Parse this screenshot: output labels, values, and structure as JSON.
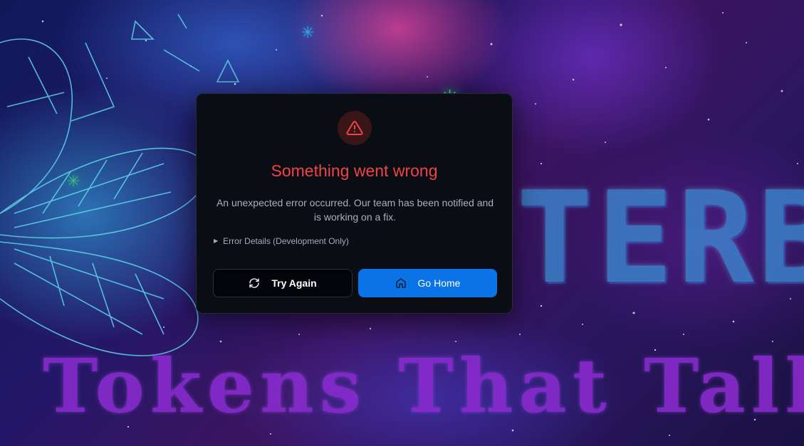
{
  "background": {
    "banner_word": "TERBY",
    "tagline": "Tokens That Talk",
    "colors": {
      "banner_word": "#3d8fd6",
      "tagline": "#8b2bd1",
      "sparkle": "#4ade80"
    }
  },
  "error_card": {
    "icon": "alert-triangle-icon",
    "title": "Something went wrong",
    "message": "An unexpected error occurred. Our team has been notified and is working on a fix.",
    "details_toggle": "Error Details (Development Only)",
    "details_expanded": false,
    "buttons": {
      "try_again": {
        "label": "Try Again",
        "icon": "refresh-icon"
      },
      "go_home": {
        "label": "Go Home",
        "icon": "home-icon"
      }
    },
    "colors": {
      "title": "#ef4444",
      "card_background": "#0a0d14",
      "primary_button": "#0a74e6"
    }
  }
}
